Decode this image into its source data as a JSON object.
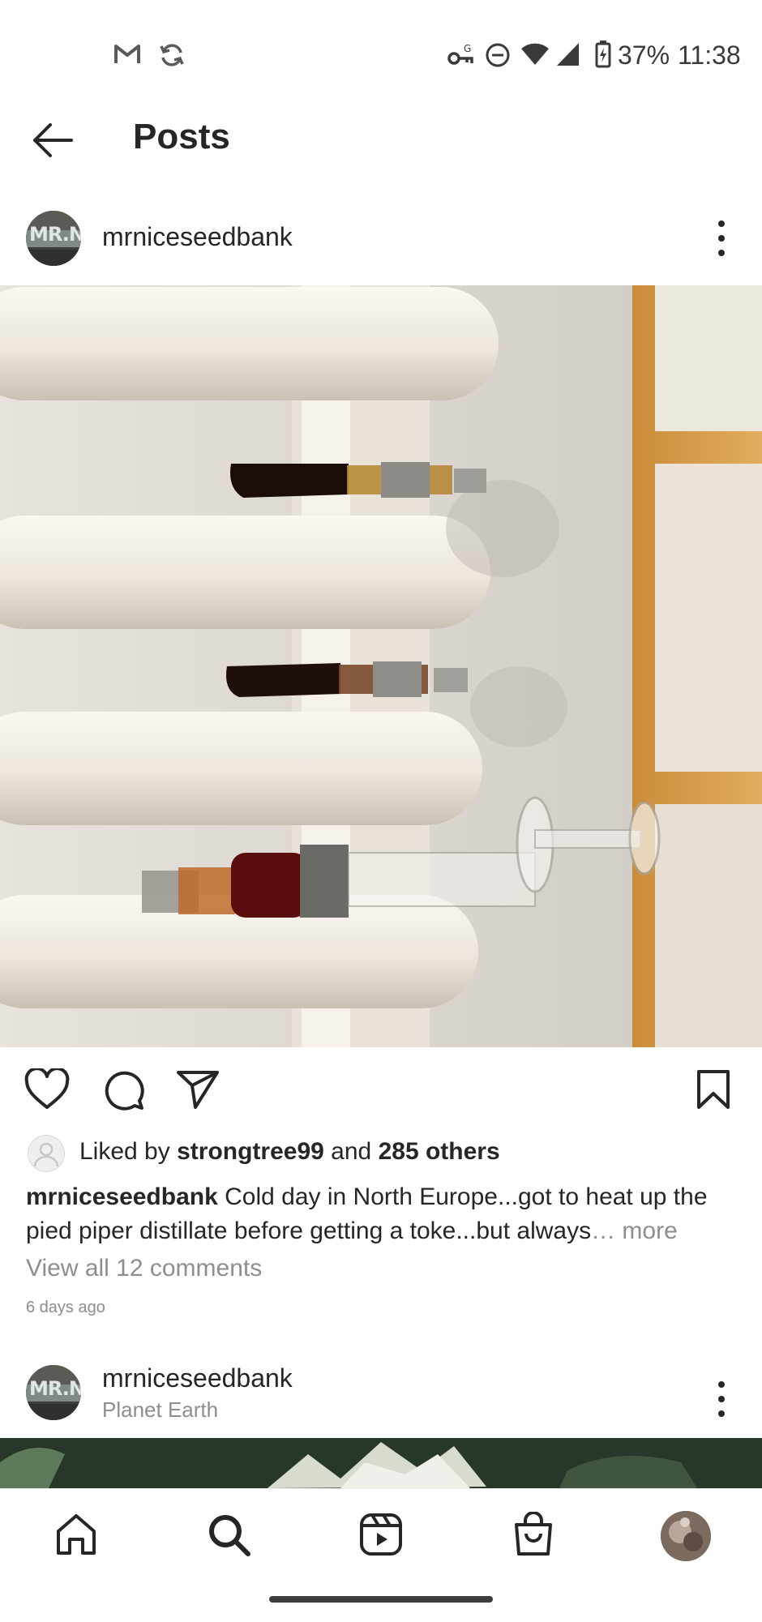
{
  "status_bar": {
    "battery": "37%",
    "time": "11:38"
  },
  "header": {
    "title": "Posts"
  },
  "post": {
    "username": "mrniceseedbank",
    "avatar_text": "MR.NI",
    "likes": {
      "prefix": "Liked by",
      "user": "strongtree99",
      "joiner": "and",
      "others": "285 others"
    },
    "caption": {
      "username": "mrniceseedbank",
      "text": "Cold day in North Europe...got to heat up the pied piper distillate before getting a toke...but always",
      "more": "… more"
    },
    "comments_link": "View all 12 comments",
    "timestamp": "6 days ago"
  },
  "post2": {
    "username": "mrniceseedbank",
    "location": "Planet Earth"
  },
  "colors": {
    "text": "#262626",
    "secondary": "#8e8e8e",
    "background": "#ffffff"
  },
  "icons": {
    "status_left": [
      "gmail-icon",
      "sync-icon"
    ],
    "status_right": [
      "vpn-key-icon",
      "do-not-disturb-icon",
      "wifi-icon",
      "cell-signal-icon",
      "battery-charging-icon"
    ],
    "actions": [
      "heart-icon",
      "comment-icon",
      "share-icon",
      "bookmark-icon"
    ],
    "nav": [
      "home-icon",
      "search-icon",
      "reels-icon",
      "shop-icon",
      "profile-avatar"
    ]
  }
}
